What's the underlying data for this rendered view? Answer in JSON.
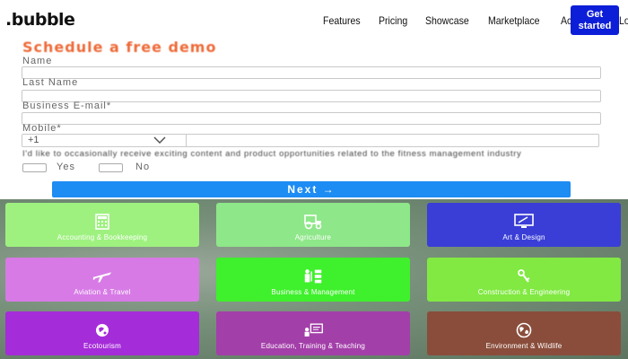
{
  "nav": {
    "logo": ".bubble",
    "links": [
      "Features",
      "Pricing",
      "Showcase",
      "Marketplace",
      "Academy",
      "Log in"
    ],
    "cta": "Get started",
    "cta_color": "#0d1ed8"
  },
  "form": {
    "title": "Schedule a free demo",
    "title_color": "#ee6a38",
    "name_label": "Name",
    "last_name_label": "Last Name",
    "email_label": "Business E-mail*",
    "mobile_label": "Mobile*",
    "phone_code": "+1",
    "consent_text": "I'd like to occasionally receive exciting content and product opportunities related to the fitness management industry",
    "yes_label": "Yes",
    "no_label": "No",
    "next_label": "Next →",
    "next_color": "#1d8cf3"
  },
  "categories": [
    {
      "label": "Accounting & Bookkeeping",
      "icon": "calculator-icon",
      "color": "#9ef17f"
    },
    {
      "label": "Agriculture",
      "icon": "tractor-icon",
      "color": "#8ee789"
    },
    {
      "label": "Art & Design",
      "icon": "monitor-icon",
      "color": "#3a3ed6"
    },
    {
      "label": "Aviation & Travel",
      "icon": "airplane-icon",
      "color": "#d77ae6"
    },
    {
      "label": "Business & Management",
      "icon": "org-chart-icon",
      "color": "#3ff02c"
    },
    {
      "label": "Construction & Engineering",
      "icon": "excavator-icon",
      "color": "#81e942"
    },
    {
      "label": "Ecotourism",
      "icon": "eco-globe-icon",
      "color": "#a52cd9"
    },
    {
      "label": "Education, Training & Teaching",
      "icon": "teacher-board-icon",
      "color": "#a33fa9"
    },
    {
      "label": "Environment & Wildlife",
      "icon": "globe-icon",
      "color": "#8a4d3b"
    }
  ]
}
